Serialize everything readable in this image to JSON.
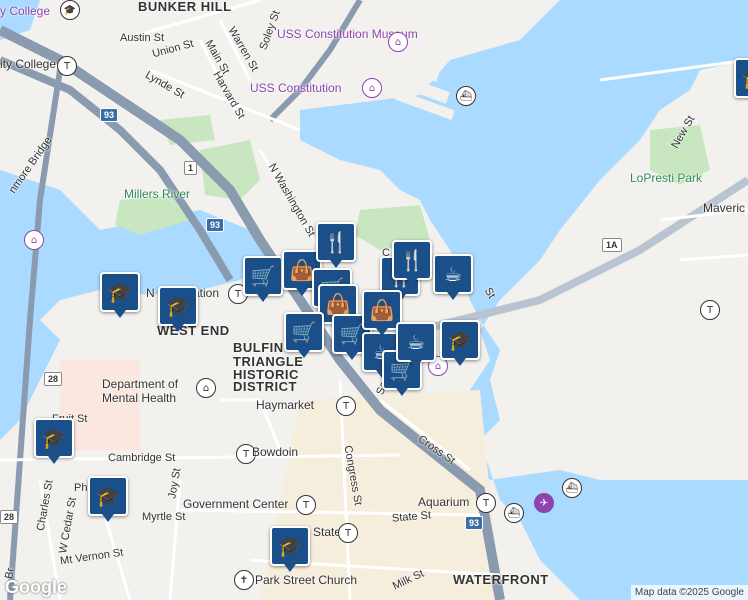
{
  "neighborhoods": [
    "BUNKER HILL",
    "WEST END",
    "BULFINCH",
    "TRIANGLE",
    "HISTORIC",
    "DISTRICT",
    "WATERFRONT"
  ],
  "streets": [
    "Austin St",
    "Union St",
    "Warren St",
    "Main St",
    "Soley St",
    "Lynde St",
    "Harvard St",
    "N Washington St",
    "Fruit St",
    "Cambridge St",
    "Joy St",
    "Charles St",
    "W Cedar St",
    "Myrtle St",
    "Mt Vernon St",
    "State St",
    "Congress St",
    "Cross St",
    "Milk St",
    "New St",
    "Sa",
    "St",
    "Ph",
    "C",
    "Br",
    "nmore Bridge"
  ],
  "pois": {
    "museum": "USS Constitution Museum",
    "ship": "USS Constitution",
    "college_top": "y College",
    "college_left": "ity College",
    "river": "Millers River",
    "park": "LoPresti Park",
    "station": "North Station",
    "station_short": "N",
    "station_tail": "ation",
    "dept": "Department of",
    "dept2": "Mental Health",
    "haymarket": "Haymarket",
    "bowdoin": "Bowdoin",
    "gov": "Government Center",
    "state": "State",
    "aquarium": "Aquarium",
    "church": "Park Street Church",
    "maverick": "Maveric"
  },
  "shields": [
    "93",
    "1",
    "93",
    "1A",
    "28",
    "93",
    "28"
  ],
  "markers": [
    {
      "icon": "graduation-cap-icon",
      "glyph": "🎓"
    },
    {
      "icon": "graduation-cap-icon",
      "glyph": "🎓"
    },
    {
      "icon": "shopping-cart-icon",
      "glyph": "🛒"
    },
    {
      "icon": "shopping-bag-icon",
      "glyph": "👜"
    },
    {
      "icon": "restaurant-icon",
      "glyph": "🍴"
    },
    {
      "icon": "shopping-cart-icon",
      "glyph": "🛒"
    },
    {
      "icon": "shopping-bag-icon",
      "glyph": "👜"
    },
    {
      "icon": "shopping-cart-icon",
      "glyph": "🛒"
    },
    {
      "icon": "shopping-cart-icon",
      "glyph": "🛒"
    },
    {
      "icon": "coffee-icon",
      "glyph": "☕"
    },
    {
      "icon": "coffee-icon",
      "glyph": "☕"
    },
    {
      "icon": "shopping-cart-icon",
      "glyph": "🛒"
    },
    {
      "icon": "graduation-cap-icon",
      "glyph": "🎓"
    },
    {
      "icon": "restaurant-icon",
      "glyph": "🍴"
    },
    {
      "icon": "shopping-bag-icon",
      "glyph": "👜"
    },
    {
      "icon": "graduation-cap-icon",
      "glyph": "🎓"
    },
    {
      "icon": "graduation-cap-icon",
      "glyph": "🎓"
    },
    {
      "icon": "graduation-cap-icon",
      "glyph": "🎓"
    },
    {
      "icon": "restaurant-icon",
      "glyph": "🍴"
    },
    {
      "icon": "coffee-icon",
      "glyph": "☕"
    },
    {
      "icon": "graduation-cap-icon",
      "glyph": "🎓"
    }
  ],
  "google_logo": "Google",
  "attribution": "Map data ©2025 Google",
  "colors": {
    "water": "#aadaff",
    "marker": "#1b4f8a",
    "park": "#c8e6c0",
    "highway": "#8a9bb0"
  }
}
